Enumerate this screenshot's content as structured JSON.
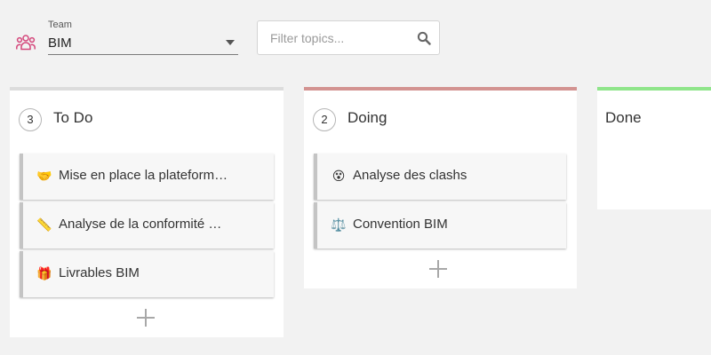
{
  "header": {
    "team_icon": "team-icon",
    "team_label": "Team",
    "team_value": "BIM",
    "filter_placeholder": "Filter topics...",
    "filter_value": "",
    "search_icon": "search-icon"
  },
  "colors": {
    "todo_accent": "#dcdcdc",
    "doing_accent": "#d39391",
    "done_accent": "#8fe58a",
    "card_stripe": "#c4c4c4",
    "team_icon": "#d4477b"
  },
  "columns": {
    "todo": {
      "title": "To Do",
      "count": "3",
      "cards": [
        {
          "emoji": "🤝",
          "title": "Mise en place la plateform…"
        },
        {
          "emoji": "📏",
          "title": "Analyse de la conformité …"
        },
        {
          "emoji": "🎁",
          "title": "Livrables BIM"
        }
      ]
    },
    "doing": {
      "title": "Doing",
      "count": "2",
      "cards": [
        {
          "emoji": "😵",
          "title": "Analyse des clashs"
        },
        {
          "emoji": "⚖️",
          "title": "Convention BIM"
        }
      ]
    },
    "done": {
      "title": "Done"
    }
  }
}
